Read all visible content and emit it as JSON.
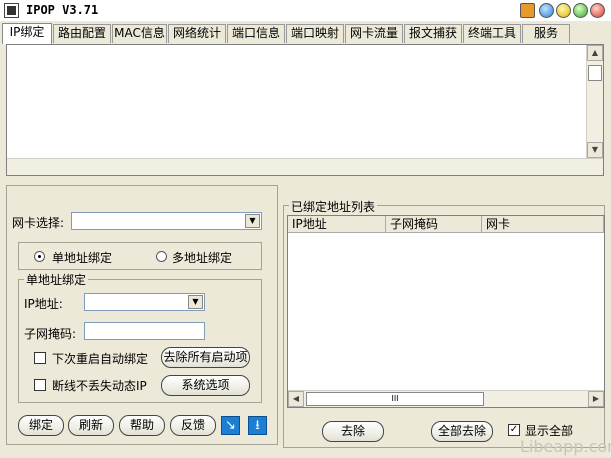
{
  "window": {
    "title": "IPOP V3.71"
  },
  "tabs": [
    "IP绑定",
    "路由配置",
    "MAC信息",
    "网络统计",
    "端口信息",
    "端口映射",
    "网卡流量",
    "报文捕获",
    "终端工具",
    "服务"
  ],
  "left": {
    "nic_label": "网卡选择:",
    "nic_value": "",
    "radio_single": "单地址绑定",
    "radio_multi": "多地址绑定",
    "group_title": "单地址绑定",
    "ip_label": "IP地址:",
    "mask_label": "子网掩码:",
    "cb_restart": "下次重启自动绑定",
    "cb_dynamic": "断线不丢失动态IP",
    "btn_remove_all_startup": "去除所有启动项",
    "btn_system_options": "系统选项",
    "btn_bind": "绑定",
    "btn_refresh": "刷新",
    "btn_help": "帮助",
    "btn_feedback": "反馈"
  },
  "right": {
    "group_title": "已绑定地址列表",
    "columns": [
      "IP地址",
      "子网掩码",
      "网卡"
    ],
    "rows": [],
    "btn_remove": "去除",
    "btn_remove_all": "全部去除",
    "cb_show_all": "显示全部"
  },
  "scroll": {
    "thumb": "III"
  },
  "watermark": "Libeapp.com",
  "colors": {
    "icon_button": "#1c7fd6",
    "panel_bg": "#ece9d8"
  }
}
